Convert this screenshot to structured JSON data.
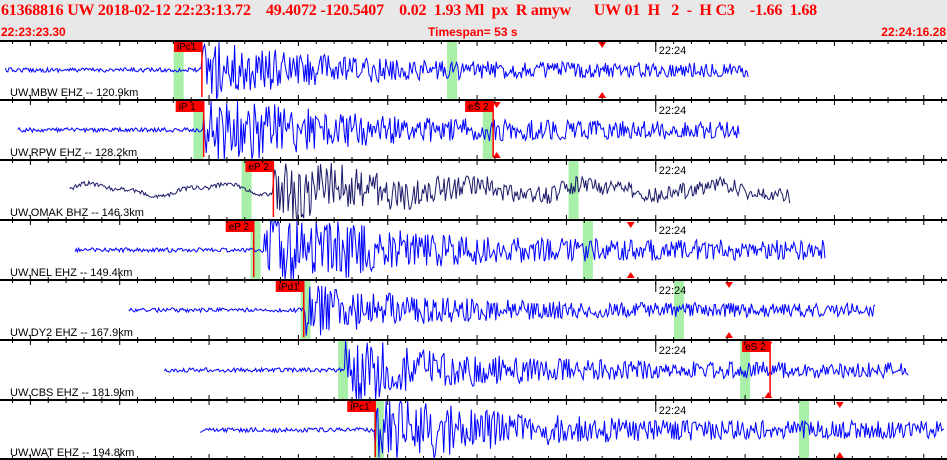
{
  "header": {
    "title": "61368816 UW 2018-02-12 22:23:13.72    49.4072 -120.5407    0.02  1.93 Ml  px  R amyw      UW 01  H   2  -  H C3    -1.66  1.68",
    "start_time": "22:23:23.30",
    "timespan": "Timespan=  53 s",
    "end_time": "22:24:16.28"
  },
  "timeline": {
    "span_s": 53,
    "minute_mark_s": 36.7,
    "minute_label": "22:24"
  },
  "colors": {
    "trace": "#0000ff",
    "trace_alt": "#1c1c6a",
    "pick": "#ff0000",
    "window": "#a8f0a8"
  },
  "panels": [
    {
      "label": "UW.MBW EHZ -- 120.9km",
      "start": 0.3,
      "end": 41.9,
      "arrival": 11.3,
      "amp": 1.0,
      "picks": [
        {
          "label": "iPc1",
          "t": 11.3
        }
      ],
      "green": [
        10.0,
        25.3
      ],
      "tri": [
        33.7
      ],
      "alt": false
    },
    {
      "label": "UW.RPW EHZ -- 128.2km",
      "start": 1.0,
      "end": 41.4,
      "arrival": 11.4,
      "amp": 1.3,
      "picks": [
        {
          "label": "iP 1",
          "t": 11.4
        },
        {
          "label": "eS 2",
          "t": 27.6
        }
      ],
      "green": [
        11.1,
        27.3
      ],
      "tri": [
        27.8
      ],
      "alt": false
    },
    {
      "label": "UW.OMAK BHZ -- 146.3km",
      "start": 3.9,
      "end": 44.2,
      "arrival": 15.3,
      "amp": 1.0,
      "picks": [
        {
          "label": "eP 2",
          "t": 15.3
        }
      ],
      "green": [
        13.8,
        32.1
      ],
      "tri": [],
      "alt": true
    },
    {
      "label": "UW.NEL EHZ -- 149.4km",
      "start": 4.2,
      "end": 46.2,
      "arrival": 14.8,
      "amp": 1.5,
      "picks": [
        {
          "label": "eP 2",
          "t": 14.2
        }
      ],
      "green": [
        14.3,
        32.9
      ],
      "tri": [
        35.3
      ],
      "alt": false
    },
    {
      "label": "UW.DY2 EHZ -- 167.9km",
      "start": 7.2,
      "end": 49.0,
      "arrival": 17.0,
      "amp": 0.9,
      "picks": [
        {
          "label": "iPd1",
          "t": 17.0
        }
      ],
      "green": [
        17.1,
        38.0
      ],
      "tri": [
        40.8
      ],
      "alt": false
    },
    {
      "label": "UW.CBS EHZ -- 181.9km",
      "start": 9.2,
      "end": 50.9,
      "arrival": 19.3,
      "amp": 1.1,
      "picks": [
        {
          "label": "eS 2",
          "t": 43.1
        }
      ],
      "green": [
        19.2,
        41.7
      ],
      "tri": [
        43.0
      ],
      "alt": false
    },
    {
      "label": "UW.WAT EHZ -- 194.8km",
      "start": 11.2,
      "end": 52.9,
      "arrival": 21.0,
      "amp": 1.3,
      "picks": [
        {
          "label": "iPc1",
          "t": 21.0
        }
      ],
      "green": [
        21.2,
        45.0
      ],
      "tri": [
        47.0
      ],
      "alt": false
    }
  ]
}
